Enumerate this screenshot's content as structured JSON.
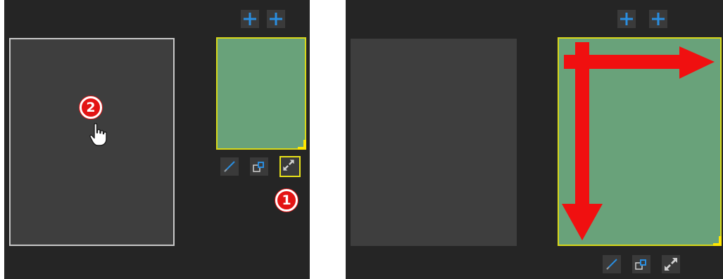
{
  "icons": {
    "add": "plus-icon",
    "edit": "pencil-icon",
    "duplicate": "duplicate-icon",
    "resize": "expand-icon",
    "pointer": "hand-pointer-icon"
  },
  "colors": {
    "panel_bg": "#252525",
    "canvas_bg": "#3e3e3e",
    "widget_fill": "#69a27a",
    "highlight": "#e8e21a",
    "accent_blue": "#2a8ee0",
    "callout_red": "#e31414"
  },
  "callouts": {
    "step1": "1",
    "step2": "2"
  }
}
